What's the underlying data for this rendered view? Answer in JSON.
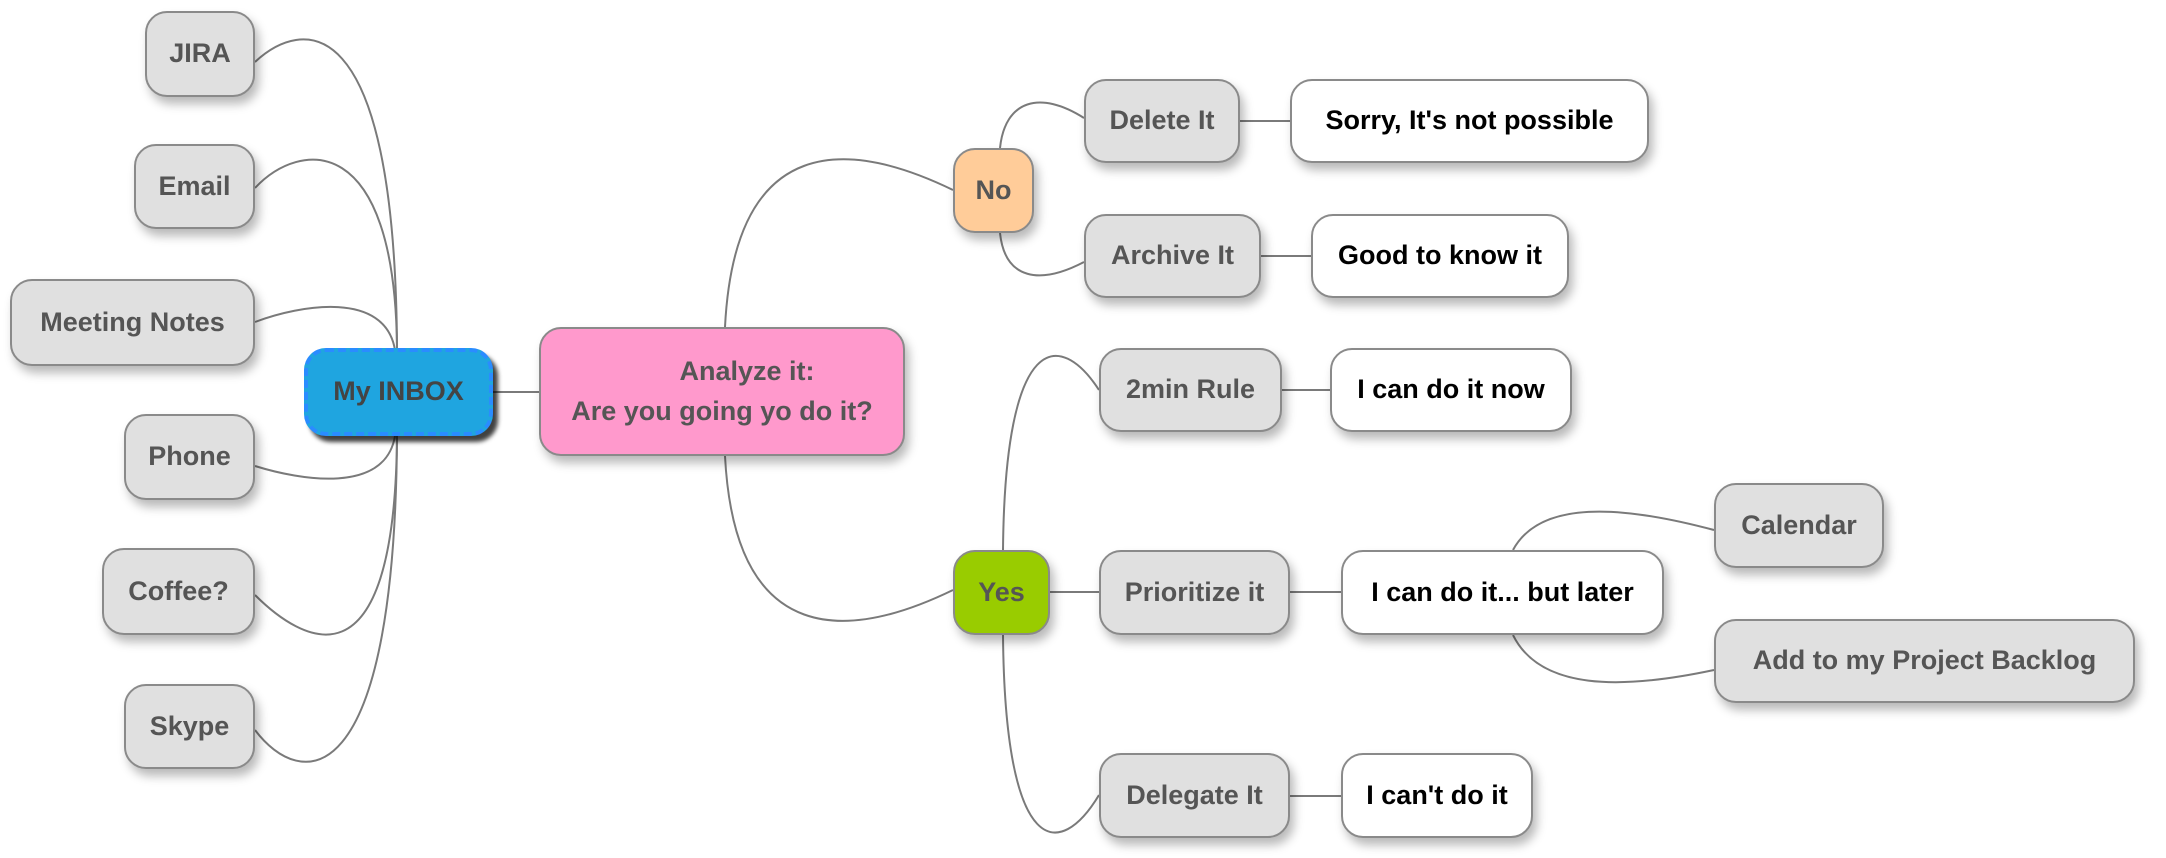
{
  "colors": {
    "inbox": "#1fa5e0",
    "analyze": "#ff99cc",
    "no": "#ffcc99",
    "yes": "#99cc00",
    "topic": "#e0e0e0",
    "result": "#ffffff"
  },
  "inbox": {
    "label": "My INBOX",
    "sources": [
      "JIRA",
      "Email",
      "Meeting Notes",
      "Phone",
      "Coffee?",
      "Skype"
    ]
  },
  "analyze": {
    "line1": "Analyze it:",
    "line2": "Are you going yo do it?"
  },
  "no": {
    "label": "No",
    "delete": "Delete It",
    "delete_result": "Sorry, It's not possible",
    "archive": "Archive It",
    "archive_result": "Good to know it"
  },
  "yes": {
    "label": "Yes",
    "rule": "2min Rule",
    "rule_result": "I can do it now",
    "prioritize": "Prioritize it",
    "prioritize_result": "I can do it... but later",
    "calendar": "Calendar",
    "backlog": "Add to my Project Backlog",
    "delegate": "Delegate It",
    "delegate_result": "I can't do it"
  }
}
